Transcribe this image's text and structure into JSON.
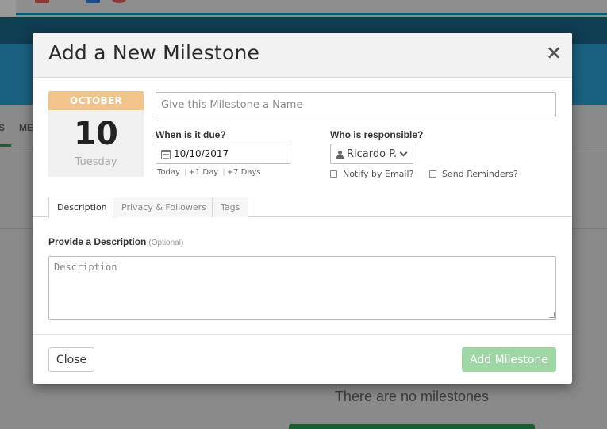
{
  "background": {
    "tabs": [
      {
        "label": "S"
      },
      {
        "label": "ME"
      }
    ],
    "empty_message": "There are no milestones"
  },
  "modal": {
    "title": "Add a New Milestone",
    "close_icon": "×",
    "date_card": {
      "month": "OCTOBER",
      "day": "10",
      "weekday": "Tuesday"
    },
    "name_input": {
      "placeholder": "Give this Milestone a Name",
      "value": ""
    },
    "due": {
      "label": "When is it due?",
      "value": "10/10/2017",
      "quick_links": [
        "Today",
        "+1 Day",
        "+7 Days"
      ]
    },
    "responsible": {
      "label": "Who is responsible?",
      "value": "Ricardo P."
    },
    "notify_email": {
      "label": "Notify by Email?",
      "checked": false
    },
    "send_reminders": {
      "label": "Send Reminders?",
      "checked": false
    },
    "tabs": [
      {
        "label": "Description",
        "active": true
      },
      {
        "label": "Privacy & Followers",
        "active": false
      },
      {
        "label": "Tags",
        "active": false
      }
    ],
    "description": {
      "label": "Provide a Description",
      "optional": "(Optional)",
      "placeholder": "Description"
    },
    "footer": {
      "close_label": "Close",
      "add_label": "Add Milestone"
    }
  },
  "colors": {
    "accent_month": "#f1c48c",
    "add_button": "#9fd6a6",
    "banner": "#1a6180",
    "nav": "#0f3d52"
  }
}
